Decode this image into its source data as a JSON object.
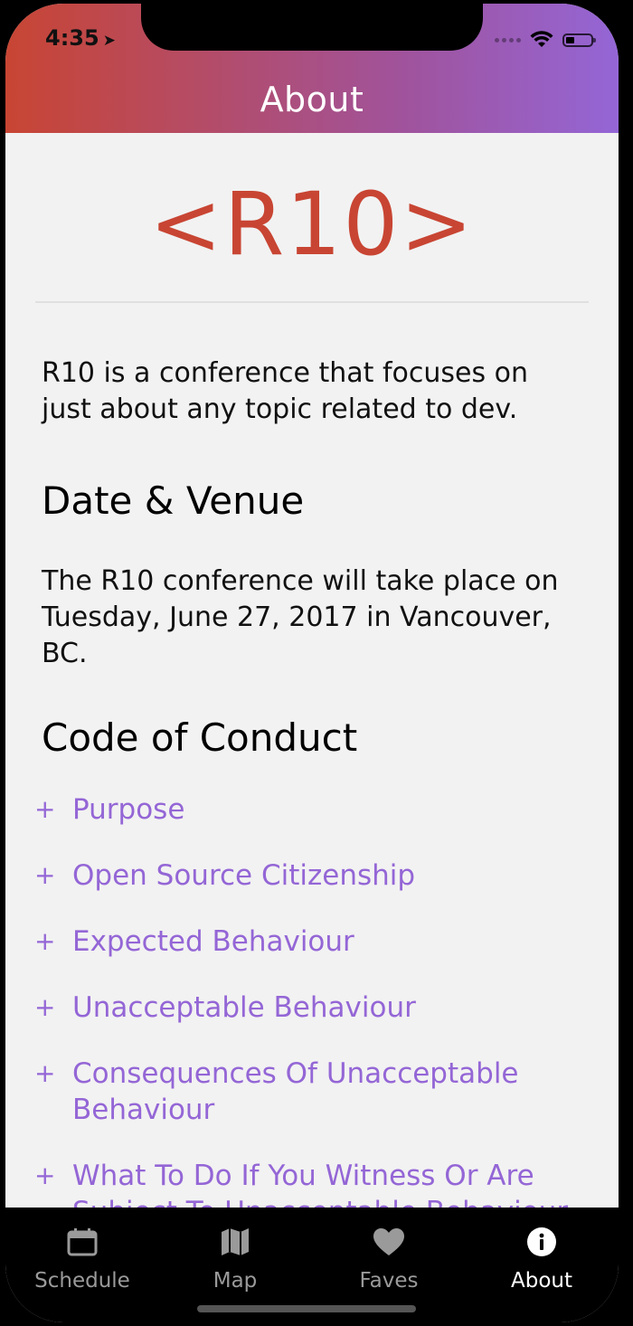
{
  "status_bar": {
    "time": "4:35"
  },
  "header": {
    "title": "About"
  },
  "logo": {
    "text": "<R10>"
  },
  "intro": "R10 is a conference that focuses on just about any topic related to dev.",
  "venue": {
    "heading": "Date & Venue",
    "text": "The R10 conference will take place on Tuesday, June 27, 2017 in Vancouver, BC."
  },
  "code_of_conduct": {
    "heading": "Code of Conduct",
    "items": [
      {
        "label": "Purpose"
      },
      {
        "label": "Open Source Citizenship"
      },
      {
        "label": "Expected Behaviour"
      },
      {
        "label": "Unacceptable Behaviour"
      },
      {
        "label": "Consequences Of Unacceptable Behaviour"
      },
      {
        "label": "What To Do If You Witness Or Are Subject To Unacceptable Behaviour"
      }
    ],
    "expand_symbol": "+"
  },
  "tabbar": {
    "tabs": [
      {
        "label": "Schedule",
        "icon": "calendar-icon"
      },
      {
        "label": "Map",
        "icon": "map-icon"
      },
      {
        "label": "Faves",
        "icon": "heart-icon"
      },
      {
        "label": "About",
        "icon": "info-icon"
      }
    ],
    "active_index": 3
  },
  "colors": {
    "accent_red": "#c84533",
    "accent_purple": "#9466d6",
    "tab_inactive": "#9a9a9a",
    "tab_active": "#ffffff"
  }
}
